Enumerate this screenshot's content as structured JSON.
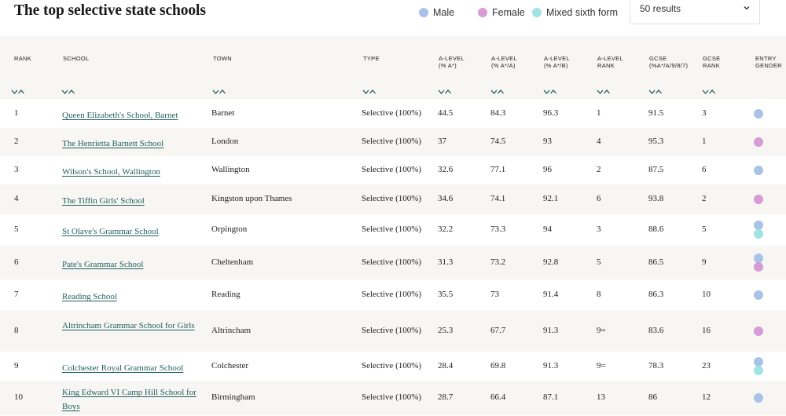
{
  "title": "The top selective state schools",
  "legend": [
    {
      "label": "Male",
      "color": "#a9c3e8"
    },
    {
      "label": "Female",
      "color": "#d79bd6"
    },
    {
      "label": "Mixed sixth form",
      "color": "#9fe3e3"
    }
  ],
  "results_select": {
    "value": "50 results"
  },
  "columns": {
    "rank": "RANK",
    "school": "SCHOOL",
    "town": "TOWN",
    "type": "TYPE",
    "alevel_a": [
      "A-LEVEL",
      "(% A*)"
    ],
    "alevel_aa": [
      "A-LEVEL",
      "(% A*/A)"
    ],
    "alevel_ab": [
      "A-LEVEL",
      "(% A*/B)"
    ],
    "alevel_rank": [
      "A-LEVEL",
      "RANK"
    ],
    "gcse": [
      "GCSE",
      "(%A*/A/9/8/7)"
    ],
    "gcse_rank": [
      "GCSE",
      "RANK"
    ],
    "entry_gender": [
      "ENTRY",
      "GENDER"
    ]
  },
  "rows": [
    {
      "rank": "1",
      "school": "Queen Elizabeth's School, Barnet",
      "town": "Barnet",
      "type": "Selective (100%)",
      "a": "44.5",
      "aa": "84.3",
      "ab": "96.3",
      "arank": "1",
      "gcse": "91.5",
      "grank": "3",
      "gender": [
        "Male"
      ]
    },
    {
      "rank": "2",
      "school": "The Henrietta Barnett School",
      "town": "London",
      "type": "Selective (100%)",
      "a": "37",
      "aa": "74.5",
      "ab": "93",
      "arank": "4",
      "gcse": "95.3",
      "grank": "1",
      "gender": [
        "Female"
      ]
    },
    {
      "rank": "3",
      "school": "Wilson's School, Wallington",
      "town": "Wallington",
      "type": "Selective (100%)",
      "a": "32.6",
      "aa": "77.1",
      "ab": "96",
      "arank": "2",
      "gcse": "87.5",
      "grank": "6",
      "gender": [
        "Male"
      ]
    },
    {
      "rank": "4",
      "school": "The Tiffin Girls' School",
      "town": "Kingston upon Thames",
      "type": "Selective (100%)",
      "a": "34.6",
      "aa": "74.1",
      "ab": "92.1",
      "arank": "6",
      "gcse": "93.8",
      "grank": "2",
      "gender": [
        "Female"
      ]
    },
    {
      "rank": "5",
      "school": "St Olave's Grammar School",
      "town": "Orpington",
      "type": "Selective (100%)",
      "a": "32.2",
      "aa": "73.3",
      "ab": "94",
      "arank": "3",
      "gcse": "88.6",
      "grank": "5",
      "gender": [
        "Male",
        "Mixed sixth form"
      ]
    },
    {
      "rank": "6",
      "school": "Pate's Grammar School",
      "town": "Cheltenham",
      "type": "Selective (100%)",
      "a": "31.3",
      "aa": "73.2",
      "ab": "92.8",
      "arank": "5",
      "gcse": "86.5",
      "grank": "9",
      "gender": [
        "Male",
        "Female"
      ]
    },
    {
      "rank": "7",
      "school": "Reading School",
      "town": "Reading",
      "type": "Selective (100%)",
      "a": "35.5",
      "aa": "73",
      "ab": "91.4",
      "arank": "8",
      "gcse": "86.3",
      "grank": "10",
      "gender": [
        "Male"
      ]
    },
    {
      "rank": "8",
      "school": "Altrincham Grammar School for Girls",
      "town": "Altrincham",
      "type": "Selective (100%)",
      "a": "25.3",
      "aa": "67.7",
      "ab": "91.3",
      "arank": "9=",
      "gcse": "83.6",
      "grank": "16",
      "gender": [
        "Female"
      ]
    },
    {
      "rank": "9",
      "school": "Colchester Royal Grammar School",
      "town": "Colchester",
      "type": "Selective (100%)",
      "a": "28.4",
      "aa": "69.8",
      "ab": "91.3",
      "arank": "9=",
      "gcse": "78.3",
      "grank": "23",
      "gender": [
        "Male",
        "Mixed sixth form"
      ]
    },
    {
      "rank": "10",
      "school": "King Edward VI Camp Hill School for Boys",
      "town": "Birmingham",
      "type": "Selective (100%)",
      "a": "28.7",
      "aa": "66.4",
      "ab": "87.1",
      "arank": "13",
      "gcse": "86",
      "grank": "12",
      "gender": [
        "Male"
      ]
    }
  ]
}
